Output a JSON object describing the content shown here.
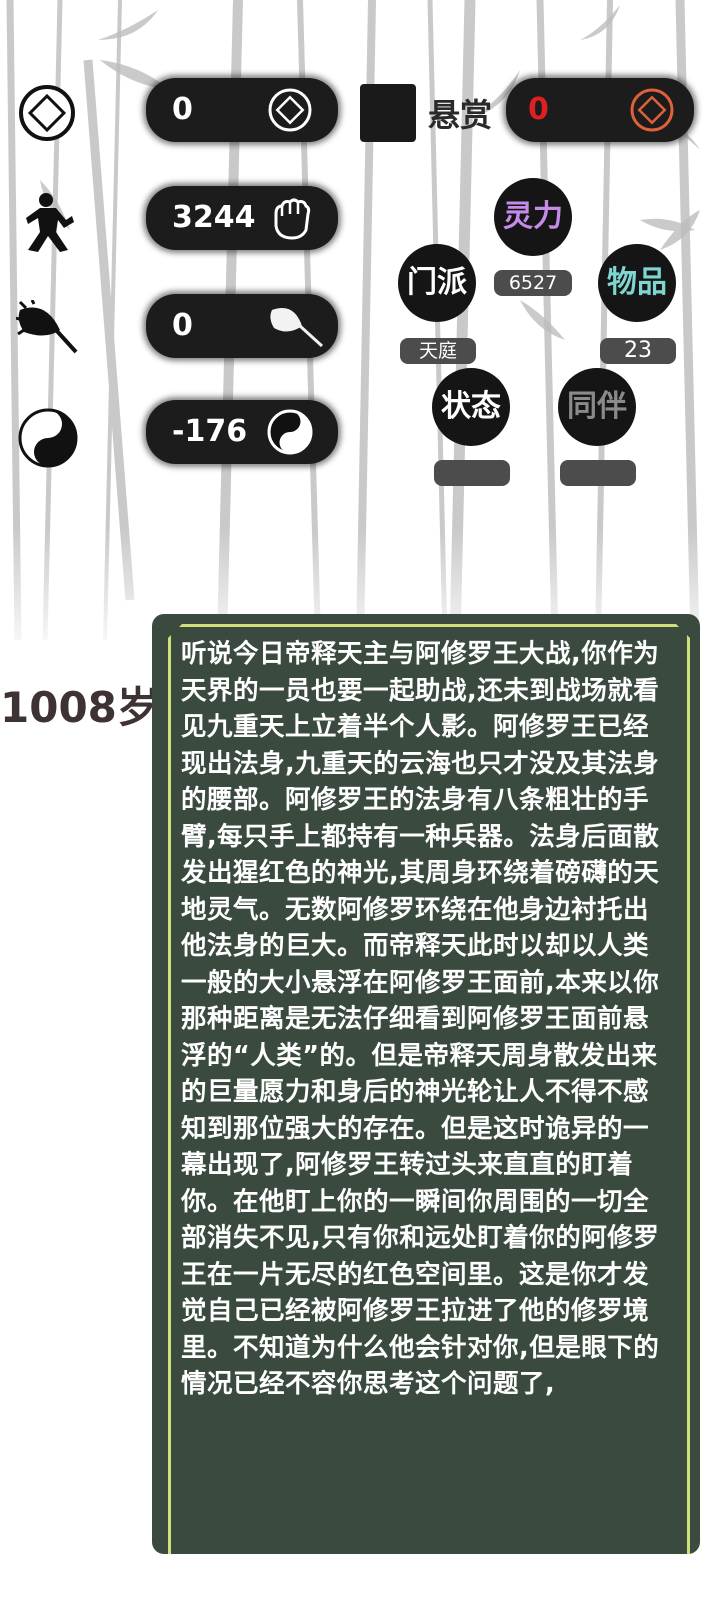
{
  "stats": [
    {
      "value": "0",
      "left_icon": "diamond-coin-icon",
      "pill_icon": "diamond-coin-icon"
    },
    {
      "value": "3244",
      "left_icon": "martial-artist-icon",
      "pill_icon": "fist-icon"
    },
    {
      "value": "0",
      "left_icon": "leaf-fan-icon",
      "pill_icon": "leaf-fan-icon"
    },
    {
      "value": "-176",
      "left_icon": "yin-yang-icon",
      "pill_icon": "yin-yang-icon"
    }
  ],
  "bounty": {
    "label": "悬赏",
    "value": "0",
    "value_color": "#e02020",
    "icon": "diamond-coin-icon",
    "icon_color": "#e0603a"
  },
  "menu": {
    "spirit": {
      "label": "灵力",
      "value": "6527",
      "color": "#c58be8"
    },
    "sect": {
      "label": "门派",
      "value": "天庭"
    },
    "items": {
      "label": "物品",
      "value": "23",
      "color": "#7fd6d0"
    },
    "status": {
      "label": "状态",
      "value": ""
    },
    "companion": {
      "label": "同伴",
      "value": "",
      "color": "#8a8a8a"
    }
  },
  "age": "1008岁",
  "story": "听说今日帝释天主与阿修罗王大战,你作为天界的一员也要一起助战,还未到战场就看见九重天上立着半个人影。阿修罗王已经现出法身,九重天的云海也只才没及其法身的腰部。阿修罗王的法身有八条粗壮的手臂,每只手上都持有一种兵器。法身后面散发出猩红色的神光,其周身环绕着磅礴的天地灵气。无数阿修罗环绕在他身边衬托出他法身的巨大。而帝释天此时以却以人类一般的大小悬浮在阿修罗王面前,本来以你那种距离是无法仔细看到阿修罗王面前悬浮的“人类”的。但是帝释天周身散发出来的巨量愿力和身后的神光轮让人不得不感知到那位强大的存在。但是这时诡异的一幕出现了,阿修罗王转过头来直直的盯着你。在他盯上你的一瞬间你周围的一切全部消失不见,只有你和远处盯着你的阿修罗王在一片无尽的红色空间里。这是你才发觉自己已经被阿修罗王拉进了他的修罗境里。不知道为什么他会针对你,但是眼下的情况已经不容你思考这个问题了,"
}
